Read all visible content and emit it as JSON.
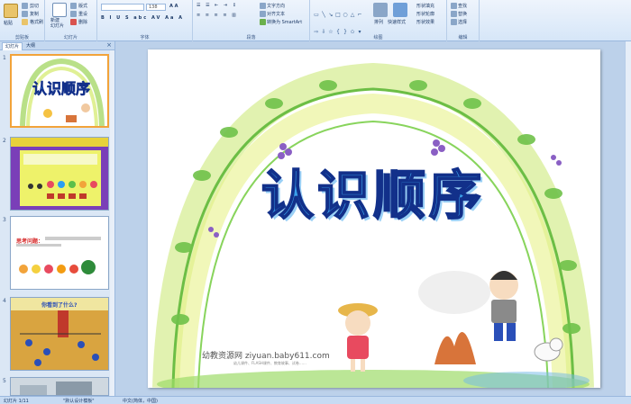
{
  "ribbon": {
    "clipboard": {
      "paste": "粘贴",
      "cut": "剪切",
      "copy": "复制",
      "format_painter": "格式刷",
      "label": "剪贴板"
    },
    "slides": {
      "new_slide": "新建\n幻灯片",
      "layout": "版式",
      "reset": "重设",
      "delete": "删除",
      "label": "幻灯片"
    },
    "font": {
      "font_size": "138",
      "label": "字体"
    },
    "paragraph": {
      "text_direction": "文字方向",
      "align_text": "对齐文本",
      "smartart": "转换为 SmartArt",
      "label": "段落"
    },
    "drawing": {
      "arrange": "排列",
      "quick_styles": "快速样式",
      "shape_fill": "形状填充",
      "shape_outline": "形状轮廓",
      "shape_effects": "形状效果",
      "label": "绘图"
    },
    "editing": {
      "find": "查找",
      "replace": "替换",
      "select": "选择",
      "label": "编辑"
    }
  },
  "left_pane": {
    "tabs": [
      "幻灯片",
      "大纲"
    ],
    "close": "×",
    "slide_numbers": [
      "1",
      "2",
      "3",
      "4",
      "5"
    ],
    "thumb3_text": "思考问题：",
    "thumb4_text": "你看到了什么?"
  },
  "slide": {
    "title": "认识顺序",
    "watermark": "幼教资源网 ziyuan.baby611.com",
    "watermark_sub": "幼儿课件、FLASH课件、教育故事、试卷……"
  },
  "status": {
    "slide_count": "幻灯片 1/11",
    "theme": "\"默认设计模板\"",
    "language": "中文(简体，中国)"
  },
  "colors": {
    "ribbon": "#dbe8f8",
    "accent": "#f2a33a",
    "title_fill": "#3aa0ea",
    "title_stroke": "#12308a"
  }
}
